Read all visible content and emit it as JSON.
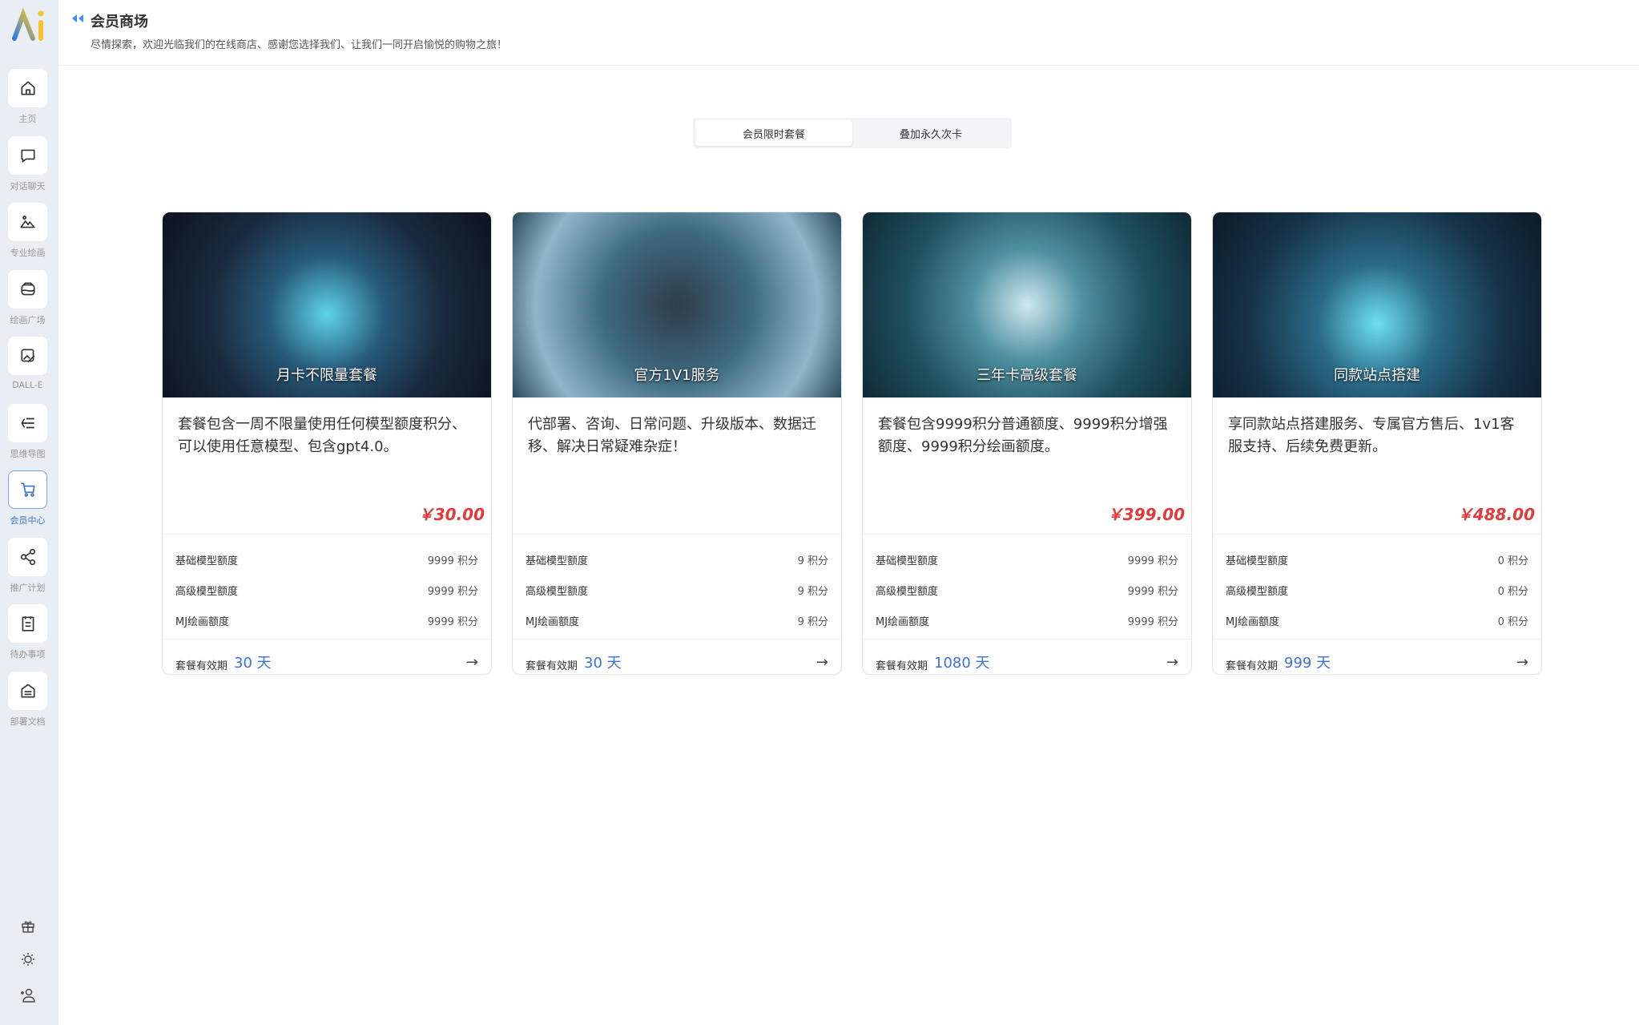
{
  "sidebar": {
    "items": [
      {
        "label": "主页",
        "icon": "home-icon"
      },
      {
        "label": "对话聊天",
        "icon": "chat-icon"
      },
      {
        "label": "专业绘画",
        "icon": "mountain-image-icon"
      },
      {
        "label": "绘画广场",
        "icon": "gallery-icon"
      },
      {
        "label": "DALL-E",
        "icon": "edit-image-icon"
      },
      {
        "label": "思维导图",
        "icon": "mindmap-icon"
      },
      {
        "label": "会员中心",
        "icon": "cart-icon",
        "active": true
      },
      {
        "label": "推广计划",
        "icon": "share-icon"
      },
      {
        "label": "待办事项",
        "icon": "clipboard-icon"
      },
      {
        "label": "部署文档",
        "icon": "document-icon"
      }
    ],
    "bottom_icons": [
      "gift-icon",
      "sun-icon",
      "add-user-icon"
    ],
    "accent": "#3d72d6"
  },
  "header": {
    "title": "会员商场",
    "subtitle": "尽情探索，欢迎光临我们的在线商店、感谢您选择我们、让我们一同开启愉悦的购物之旅！"
  },
  "tabs": [
    {
      "label": "会员限时套餐",
      "active": true
    },
    {
      "label": "叠加永久次卡",
      "active": false
    }
  ],
  "row_labels": [
    "基础模型额度",
    "高级模型额度",
    "MJ绘画额度"
  ],
  "validity_label": "套餐有效期",
  "cards": [
    {
      "caption": "月卡不限量套餐",
      "desc": "套餐包含一周不限量使用任何模型额度积分、可以使用任意模型、包含gpt4.0。",
      "price": "￥30.00",
      "values": [
        "9999 积分",
        "9999 积分",
        "9999 积分"
      ],
      "days": "30 天"
    },
    {
      "caption": "官方1V1服务",
      "desc": "代部署、咨询、日常问题、升级版本、数据迁移、解决日常疑难杂症！",
      "price": "",
      "values": [
        "9 积分",
        "9 积分",
        "9 积分"
      ],
      "days": "30 天"
    },
    {
      "caption": "三年卡高级套餐",
      "desc": "套餐包含9999积分普通额度、9999积分增强额度、9999积分绘画额度。",
      "price": "￥399.00",
      "values": [
        "9999 积分",
        "9999 积分",
        "9999 积分"
      ],
      "days": "1080 天"
    },
    {
      "caption": "同款站点搭建",
      "desc": "享同款站点搭建服务、专属官方售后、1v1客服支持、后续免费更新。",
      "price": "￥488.00",
      "values": [
        "0 积分",
        "0 积分",
        "0 积分"
      ],
      "days": "999 天"
    }
  ],
  "colors": {
    "price": "#e03a3a",
    "days": "#3d72d6"
  }
}
